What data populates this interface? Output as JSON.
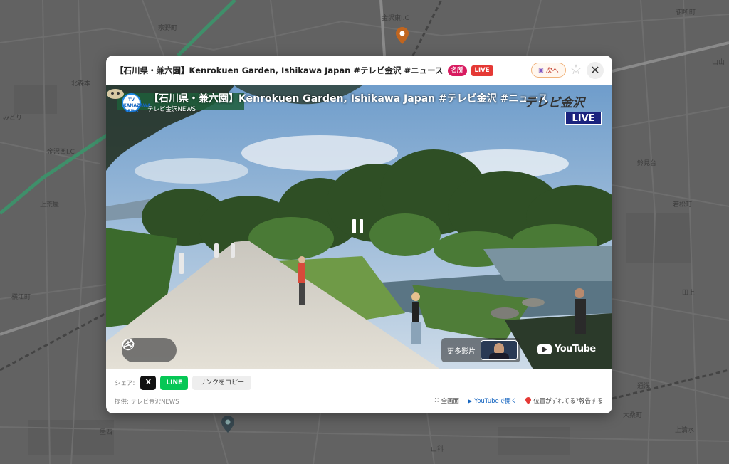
{
  "map": {
    "labels": [
      "金沢東I.C",
      "北森本",
      "御所町",
      "宗野町",
      "みどり",
      "金沢西I.C",
      "上荒屋",
      "横江町",
      "鈴見台",
      "若松町",
      "田上",
      "通浅",
      "大桑町",
      "上清水",
      "山科",
      "墨西",
      "山山"
    ]
  },
  "modal": {
    "title": "【石川県・兼六園】Kenrokuen Garden, Ishikawa Japan #テレビ金沢 #ニュース",
    "badge_meisho": "名所",
    "badge_live": "LIVE",
    "next_label": "次へ",
    "star": "☆",
    "close": "✕"
  },
  "video": {
    "logo_text": "TV KANAZAWA NEWS",
    "title": "【石川県・兼六園】Kenrokuen Garden, Ishikawa Japan #テレビ金沢 #ニュース",
    "channel": "テレビ金沢NEWS",
    "station": "テレビ金沢",
    "live": "LIVE",
    "more_videos": "更多影片",
    "youtube": "YouTube"
  },
  "footer": {
    "share_label": "シェア:",
    "x_label": "X",
    "line_label": "LINE",
    "copy_label": "リンクをコピー",
    "provider": "提供: テレビ金沢NEWS",
    "fullscreen": "全画面",
    "open_youtube": "YouTubeで開く",
    "report": "位置がずれてる?報告する"
  },
  "colors": {
    "badge_meisho": "#d81b60",
    "badge_live": "#e53935",
    "line_green": "#06c755",
    "live_bg": "#1a237e",
    "link_blue": "#1565c0"
  },
  "icons": {
    "share": "share-icon",
    "clock": "clock-icon",
    "pause": "pause-icon",
    "fullscreen": "fullscreen-icon",
    "play": "play-icon",
    "pin": "pin-icon"
  }
}
